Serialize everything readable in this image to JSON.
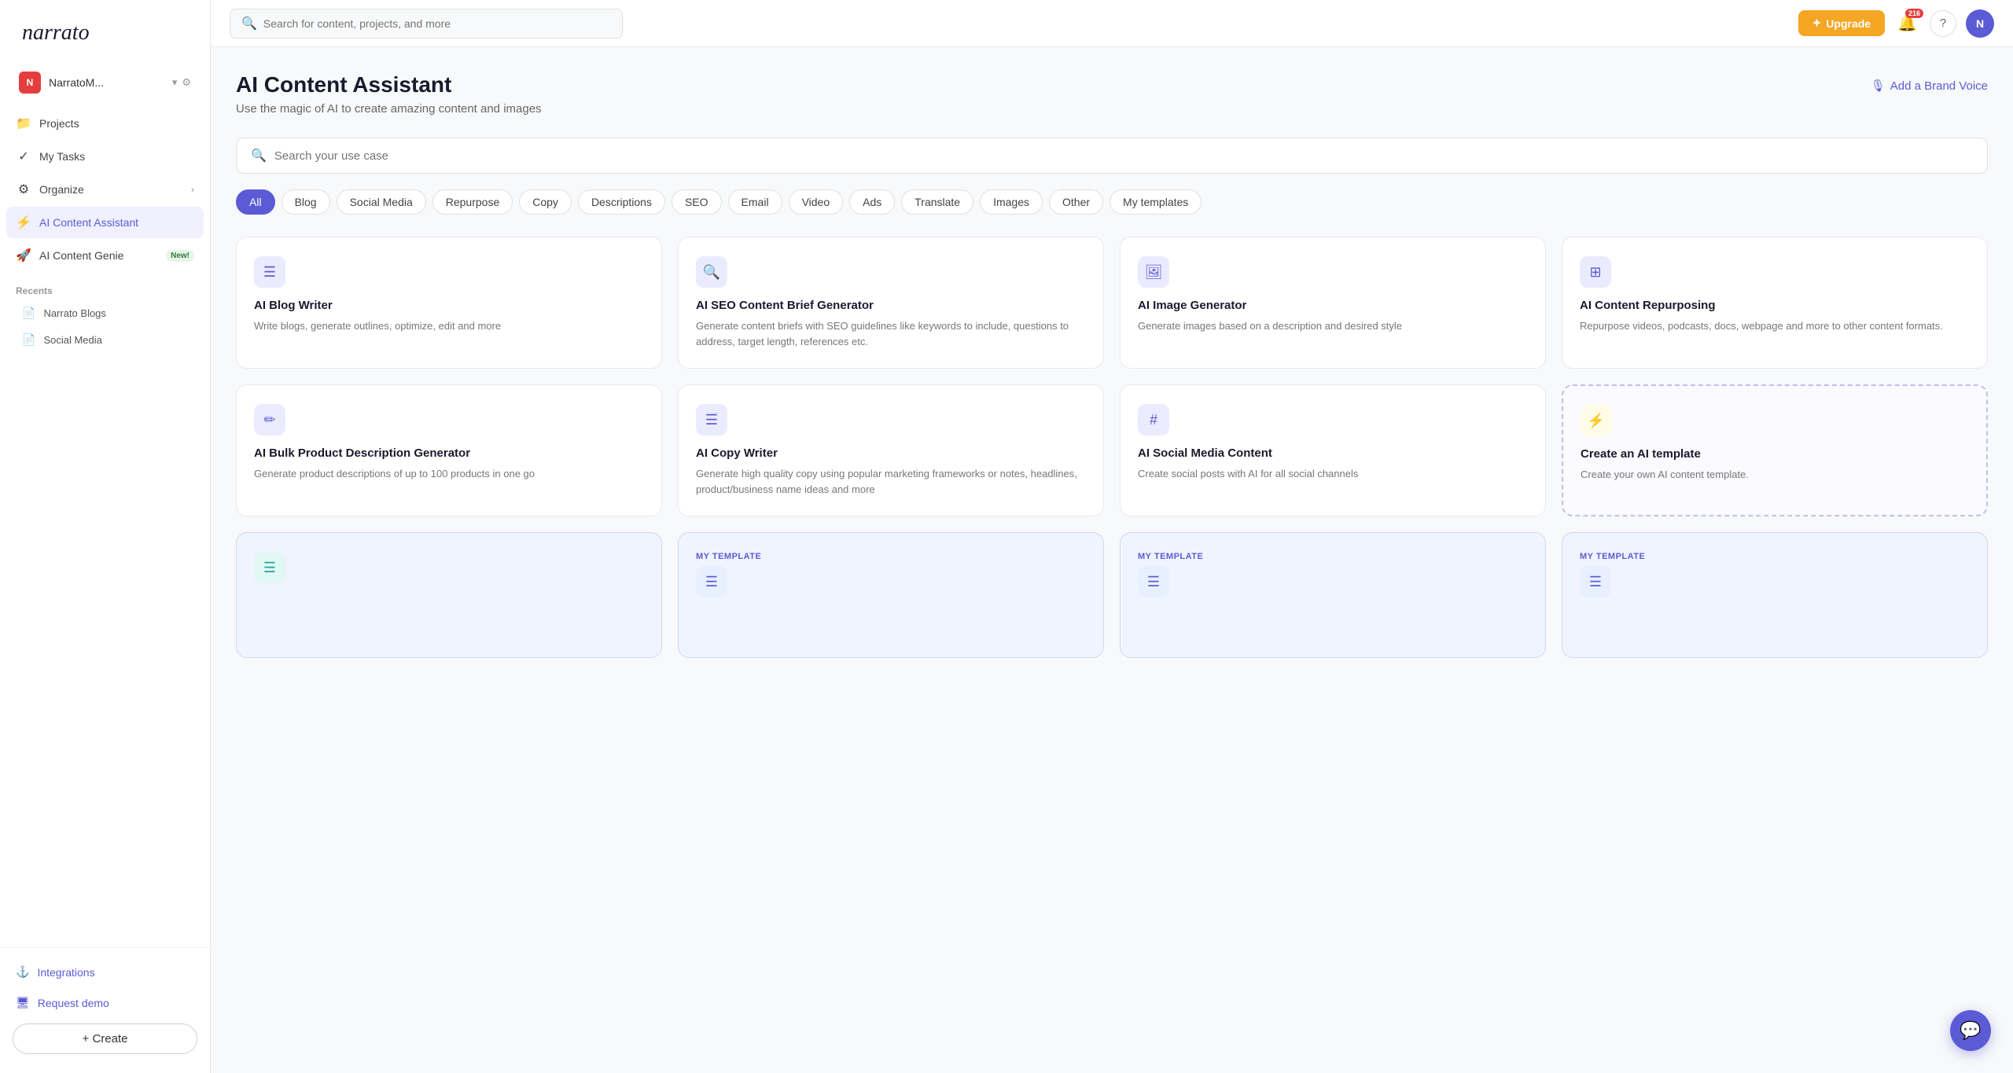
{
  "sidebar": {
    "logo_text": "narrato",
    "user": {
      "name": "NarratoM...",
      "avatar_text": "N"
    },
    "nav_items": [
      {
        "id": "projects",
        "label": "Projects",
        "icon": "📁"
      },
      {
        "id": "my-tasks",
        "label": "My Tasks",
        "icon": "✓"
      },
      {
        "id": "organize",
        "label": "Organize",
        "icon": "⚙",
        "has_arrow": true
      },
      {
        "id": "ai-content-assistant",
        "label": "AI Content Assistant",
        "icon": "⚡",
        "active": true
      },
      {
        "id": "ai-content-genie",
        "label": "AI Content Genie",
        "icon": "🚀",
        "badge": "New!"
      }
    ],
    "recents_title": "Recents",
    "recent_items": [
      {
        "id": "narrato-blogs",
        "label": "Narrato Blogs",
        "icon": "📄"
      },
      {
        "id": "social-media",
        "label": "Social Media",
        "icon": "📄"
      }
    ],
    "bottom_items": [
      {
        "id": "integrations",
        "label": "Integrations",
        "icon": "⚓"
      },
      {
        "id": "request-demo",
        "label": "Request demo",
        "icon": "🖥"
      }
    ],
    "create_button_label": "+ Create"
  },
  "topbar": {
    "search_placeholder": "Search for content, projects, and more",
    "upgrade_label": "Upgrade",
    "notification_count": "216",
    "help_icon": "?"
  },
  "page": {
    "title": "AI Content Assistant",
    "subtitle": "Use the magic of AI to create amazing content and images",
    "add_brand_voice_label": "Add a Brand Voice",
    "use_case_placeholder": "Search your use case",
    "filters": [
      {
        "id": "all",
        "label": "All",
        "active": true
      },
      {
        "id": "blog",
        "label": "Blog"
      },
      {
        "id": "social-media",
        "label": "Social Media"
      },
      {
        "id": "repurpose",
        "label": "Repurpose"
      },
      {
        "id": "copy",
        "label": "Copy"
      },
      {
        "id": "descriptions",
        "label": "Descriptions"
      },
      {
        "id": "seo",
        "label": "SEO"
      },
      {
        "id": "email",
        "label": "Email"
      },
      {
        "id": "video",
        "label": "Video"
      },
      {
        "id": "ads",
        "label": "Ads"
      },
      {
        "id": "translate",
        "label": "Translate"
      },
      {
        "id": "images",
        "label": "Images"
      },
      {
        "id": "other",
        "label": "Other"
      },
      {
        "id": "my-templates",
        "label": "My templates"
      }
    ],
    "cards": [
      {
        "id": "blog-writer",
        "title": "AI Blog Writer",
        "desc": "Write blogs, generate outlines, optimize, edit and more",
        "icon": "☰",
        "icon_style": "default"
      },
      {
        "id": "seo-brief",
        "title": "AI SEO Content Brief Generator",
        "desc": "Generate content briefs with SEO guidelines like keywords to include, questions to address, target length, references etc.",
        "icon": "🔍",
        "icon_style": "default"
      },
      {
        "id": "image-generator",
        "title": "AI Image Generator",
        "desc": "Generate images based on a description and desired style",
        "icon": "🖼",
        "icon_style": "default"
      },
      {
        "id": "content-repurposing",
        "title": "AI Content Repurposing",
        "desc": "Repurpose videos, podcasts, docs, webpage and more to other content formats.",
        "icon": "⊞",
        "icon_style": "default"
      },
      {
        "id": "bulk-product-desc",
        "title": "AI Bulk Product Description Generator",
        "desc": "Generate product descriptions of up to 100 products in one go",
        "icon": "✏",
        "icon_style": "default"
      },
      {
        "id": "copy-writer",
        "title": "AI Copy Writer",
        "desc": "Generate high quality copy using popular marketing frameworks or notes, headlines, product/business name ideas and more",
        "icon": "☰",
        "icon_style": "default"
      },
      {
        "id": "social-media-content",
        "title": "AI Social Media Content",
        "desc": "Create social posts with AI for all social channels",
        "icon": "#",
        "icon_style": "default"
      },
      {
        "id": "create-template",
        "title": "Create an AI template",
        "desc": "Create your own AI content template.",
        "icon": "⚡",
        "icon_style": "yellow",
        "dashed": true
      }
    ],
    "template_cards": [
      {
        "id": "template-row-1",
        "label": "MY TEMPLATE",
        "icon": "☰"
      },
      {
        "id": "template-row-2",
        "label": "MY TEMPLATE",
        "icon": "☰"
      },
      {
        "id": "template-row-3",
        "label": "MY TEMPLATE",
        "icon": "☰"
      }
    ],
    "bottom_row_card": {
      "id": "bottom-list-card",
      "icon": "☰",
      "icon_style": "teal"
    }
  }
}
